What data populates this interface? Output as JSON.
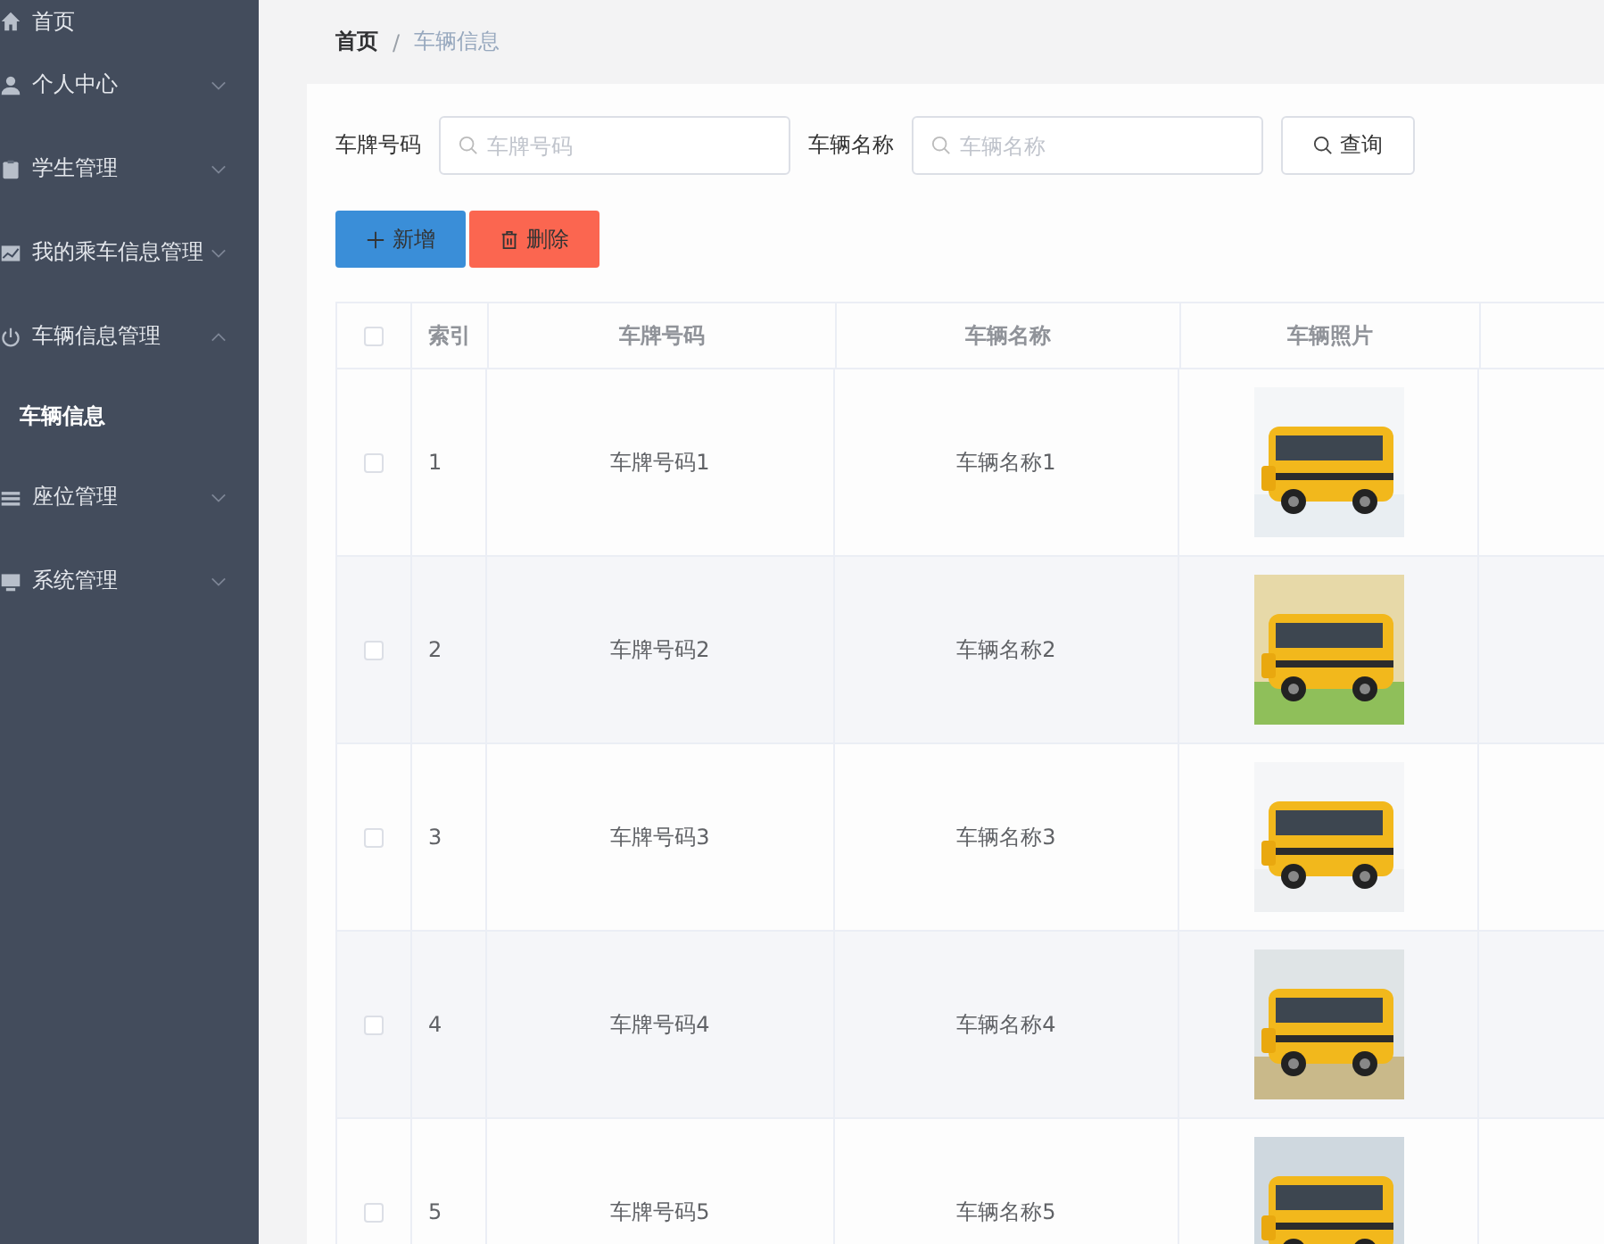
{
  "sidebar": {
    "items": [
      {
        "label": "首页",
        "kind": "link",
        "selected": false
      },
      {
        "label": "个人中心",
        "kind": "group",
        "expanded": false,
        "selected": false
      },
      {
        "label": "学生管理",
        "kind": "group",
        "expanded": false,
        "selected": false
      },
      {
        "label": "我的乘车信息管理",
        "kind": "group",
        "expanded": false,
        "selected": false
      },
      {
        "label": "车辆信息管理",
        "kind": "group",
        "expanded": true,
        "selected": false,
        "children": [
          {
            "label": "车辆信息",
            "selected": true
          }
        ]
      },
      {
        "label": "座位管理",
        "kind": "group",
        "expanded": false,
        "selected": false
      },
      {
        "label": "系统管理",
        "kind": "group",
        "expanded": false,
        "selected": false
      }
    ]
  },
  "breadcrumb": {
    "separator": "/",
    "items": [
      "首页",
      "车辆信息"
    ]
  },
  "search": {
    "fields": [
      {
        "label": "车牌号码",
        "placeholder": "车牌号码"
      },
      {
        "label": "车辆名称",
        "placeholder": "车辆名称"
      }
    ],
    "button": "查询"
  },
  "actions": [
    {
      "label": "新增",
      "kind": "add"
    },
    {
      "label": "删除",
      "kind": "delete"
    }
  ],
  "table": {
    "all_checked": false,
    "columns": [
      "索引",
      "车牌号码",
      "车辆名称",
      "车辆照片"
    ],
    "rows": [
      {
        "checked": false,
        "index": "1",
        "plate": "车牌号码1",
        "name": "车辆名称1"
      },
      {
        "checked": false,
        "index": "2",
        "plate": "车牌号码2",
        "name": "车辆名称2"
      },
      {
        "checked": false,
        "index": "3",
        "plate": "车牌号码3",
        "name": "车辆名称3"
      },
      {
        "checked": false,
        "index": "4",
        "plate": "车牌号码4",
        "name": "车辆名称4"
      },
      {
        "checked": false,
        "index": "5",
        "plate": "车牌号码5",
        "name": "车辆名称5"
      }
    ]
  }
}
